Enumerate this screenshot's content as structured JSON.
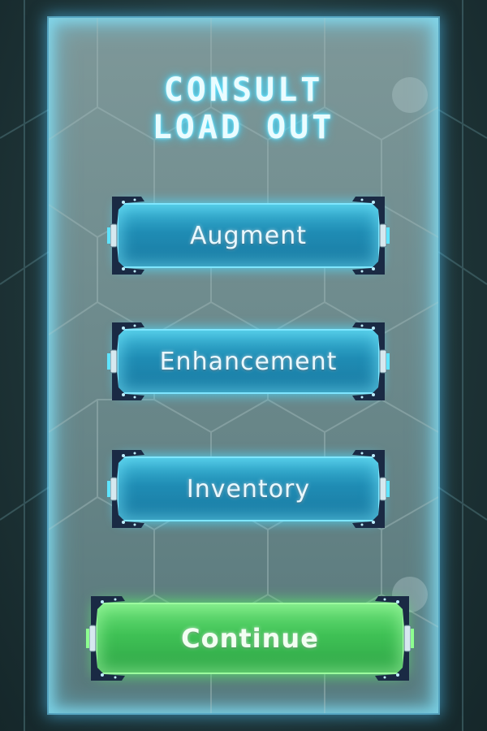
{
  "title": {
    "line1": "CONSULT",
    "line2": "LOAD OUT"
  },
  "menu": {
    "items": [
      {
        "label": "Augment"
      },
      {
        "label": "Enhancement"
      },
      {
        "label": "Inventory"
      }
    ],
    "continue_label": "Continue"
  },
  "colors": {
    "panel": "#7e9899",
    "glow": "#5fe4ff",
    "button_blue": "#1f8cb4",
    "button_green": "#3fc155",
    "frame_dark": "#1a2a44"
  }
}
